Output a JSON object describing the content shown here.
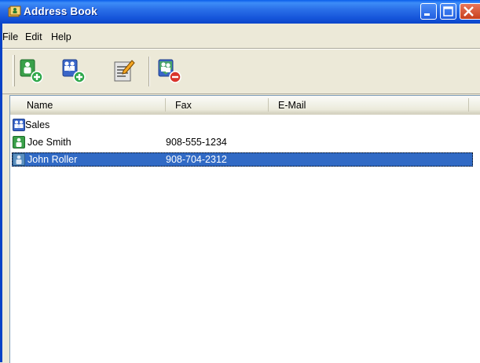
{
  "window": {
    "title": "Address Book"
  },
  "menu": {
    "items": [
      "File",
      "Edit",
      "Help"
    ]
  },
  "toolbar": {
    "buttons": [
      {
        "icon": "add-contact-icon"
      },
      {
        "icon": "add-group-icon"
      },
      {
        "icon": "edit-icon"
      },
      {
        "icon": "delete-icon"
      }
    ]
  },
  "list": {
    "columns": [
      "Name",
      "Fax",
      "E-Mail"
    ],
    "rows": [
      {
        "name": "Sales",
        "fax": "",
        "email": "",
        "type": "group",
        "selected": false
      },
      {
        "name": "Joe Smith",
        "fax": "908-555-1234",
        "email": "",
        "type": "contact",
        "selected": false
      },
      {
        "name": "John Roller",
        "fax": "908-704-2312",
        "email": "",
        "type": "contact",
        "selected": true
      }
    ]
  },
  "colors": {
    "titlebar": "#1656db",
    "selection": "#316ac5",
    "chrome": "#ece9d8"
  }
}
